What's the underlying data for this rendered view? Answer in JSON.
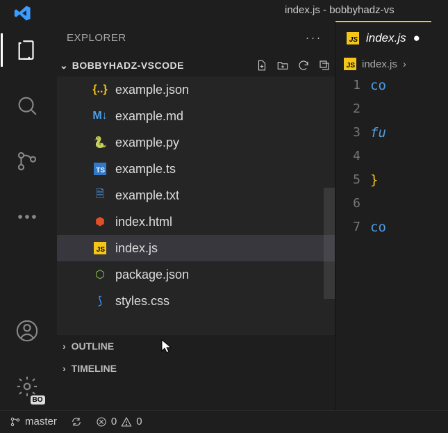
{
  "title_bar": "index.js - bobbyhadz-vs",
  "sidebar": {
    "title": "EXPLORER",
    "more": "···",
    "folder": "BOBBYHADZ-VSCODE",
    "files": [
      {
        "name": "example.json",
        "icon": "json"
      },
      {
        "name": "example.md",
        "icon": "md"
      },
      {
        "name": "example.py",
        "icon": "py"
      },
      {
        "name": "example.ts",
        "icon": "ts"
      },
      {
        "name": "example.txt",
        "icon": "txt"
      },
      {
        "name": "index.html",
        "icon": "html"
      },
      {
        "name": "index.js",
        "icon": "js",
        "selected": true
      },
      {
        "name": "package.json",
        "icon": "node"
      },
      {
        "name": "styles.css",
        "icon": "css"
      }
    ],
    "sections": [
      {
        "name": "OUTLINE"
      },
      {
        "name": "TIMELINE"
      }
    ]
  },
  "tab": {
    "label": "index.js",
    "breadcrumb": "index.js"
  },
  "editor_lines": [
    "1",
    "2",
    "3",
    "4",
    "5",
    "6",
    "7"
  ],
  "code": {
    "l1": "co",
    "l3": "fu",
    "l5": "}",
    "l7": "co"
  },
  "status": {
    "branch": "master",
    "errors": "0",
    "warnings": "0"
  },
  "bo_badge": "BO"
}
